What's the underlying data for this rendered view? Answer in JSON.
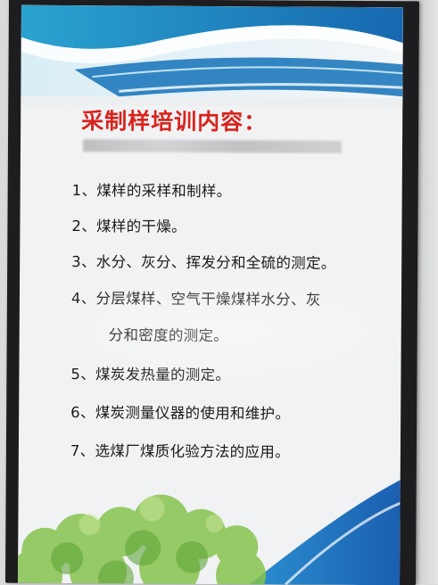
{
  "poster": {
    "title": "采制样培训内容：",
    "items": [
      "1、煤样的采样和制样。",
      "2、煤样的干燥。",
      "3、水分、灰分、挥发分和全硫的测定。",
      "4、分层煤样、空气干燥煤样水分、灰",
      "分和密度的测定。",
      "5、煤炭发热量的测定。",
      "6、煤炭测量仪器的使用和维护。",
      "7、选煤厂煤质化验方法的应用。"
    ]
  },
  "colors": {
    "title": "#d8231d",
    "text": "#1a1a1c",
    "header_blue": "#1e73b8",
    "header_teal": "#2aa0c8",
    "foliage": "#7fbf4a",
    "frame": "#1d1d1f"
  }
}
